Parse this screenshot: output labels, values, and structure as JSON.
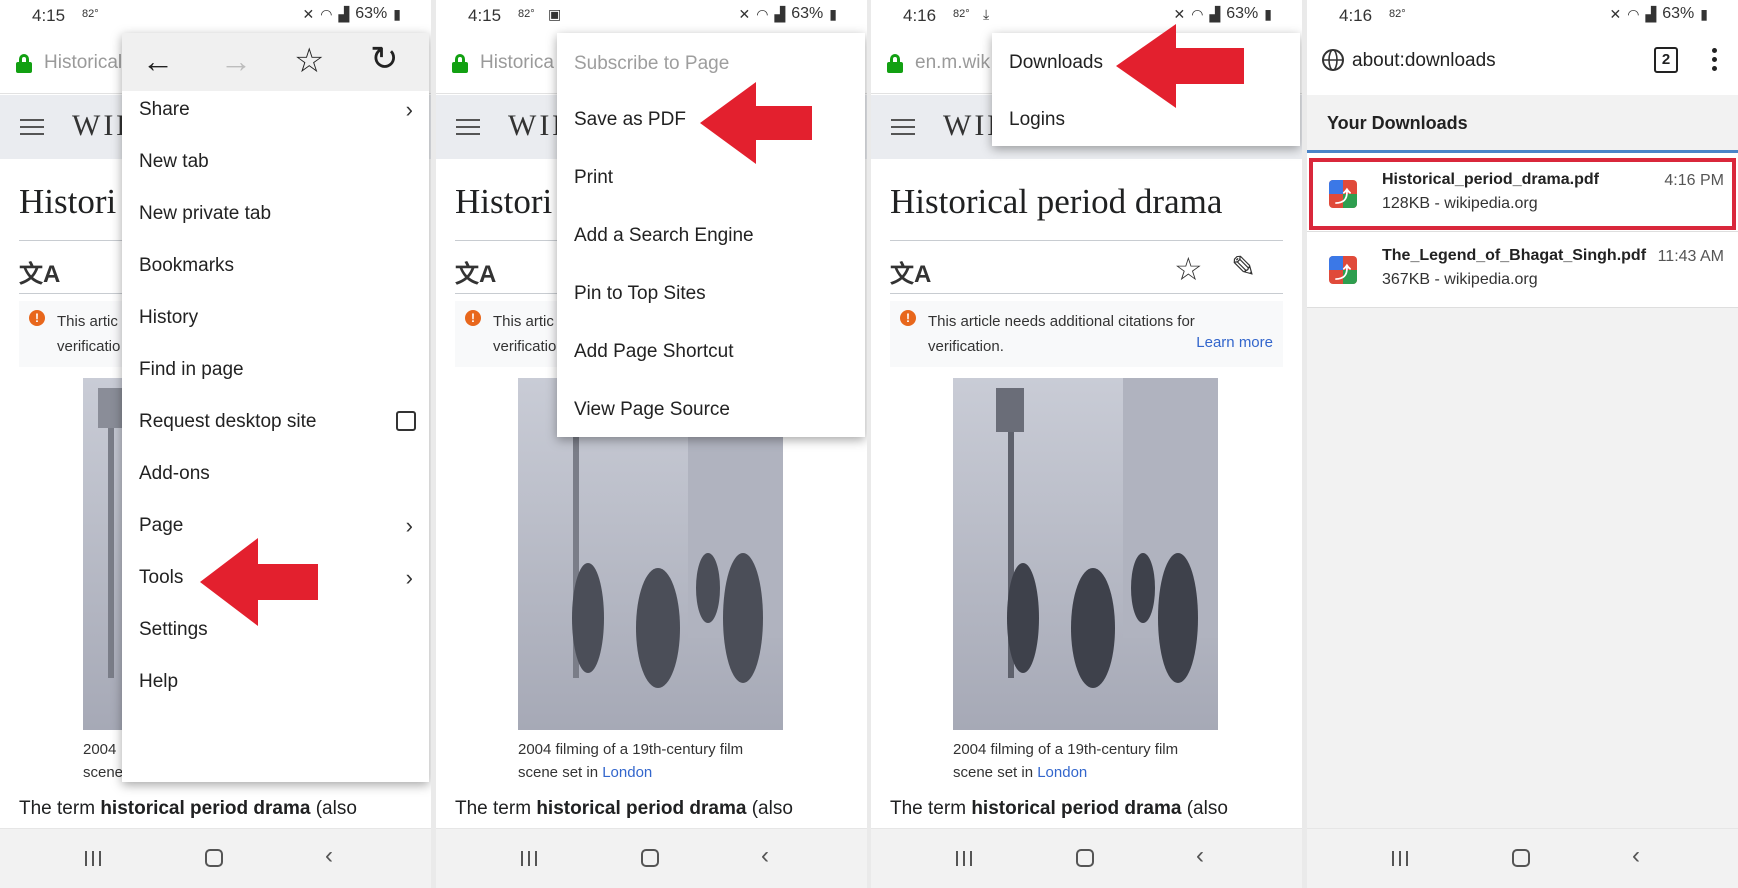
{
  "colors": {
    "arrow": "#e3202e",
    "lock": "#12a012",
    "link": "#3366cc",
    "highlight": "#d9273b",
    "tab_underline": "#4a84c8"
  },
  "common": {
    "battery": "63%",
    "wiki_logo": "WIK",
    "article_title": "Historical period drama",
    "notice_line1": "This article needs additional citations for",
    "notice_line2": "verification.",
    "learn_more": "Learn more",
    "caption_line1": "2004 filming of a 19th-century film",
    "caption_line2_pre": "scene set in ",
    "caption_link": "London",
    "body_pre": "The term ",
    "body_bold": "historical period drama",
    "body_post": " (also"
  },
  "panel1": {
    "time": "4:15",
    "temp": "82°",
    "address": "Historical",
    "menu": {
      "items": [
        "Share",
        "New tab",
        "New private tab",
        "Bookmarks",
        "History",
        "Find in page",
        "Request desktop site",
        "Add-ons",
        "Page",
        "Tools",
        "Settings",
        "Help"
      ]
    },
    "cropped_title": "Histori",
    "cropped_notice1": "This artic",
    "cropped_notice2": "verificatio",
    "cropped_caption1": "2004",
    "cropped_caption2": "scene"
  },
  "panel2": {
    "time": "4:15",
    "temp": "82°",
    "address": "Historica",
    "menu": {
      "items": [
        "Subscribe to Page",
        "Save as PDF",
        "Print",
        "Add a Search Engine",
        "Pin to Top Sites",
        "Add Page Shortcut",
        "View Page Source"
      ]
    },
    "cropped_title": "Histori",
    "cropped_notice1": "This artic",
    "cropped_notice2": "verificatio"
  },
  "panel3": {
    "time": "4:16",
    "temp": "82°",
    "address": "en.m.wik",
    "menu": {
      "items": [
        "Downloads",
        "Logins"
      ]
    }
  },
  "panel4": {
    "time": "4:16",
    "temp": "82°",
    "url": "about:downloads",
    "tab_count": "2",
    "section_title": "Your Downloads",
    "downloads": [
      {
        "name": "Historical_period_drama.pdf",
        "size": "128KB -",
        "source": "wikipedia.org",
        "time": "4:16 PM"
      },
      {
        "name": "The_Legend_of_Bhagat_Singh.pdf",
        "size": "367KB -",
        "source": "wikipedia.org",
        "time": "11:43 AM"
      }
    ]
  }
}
